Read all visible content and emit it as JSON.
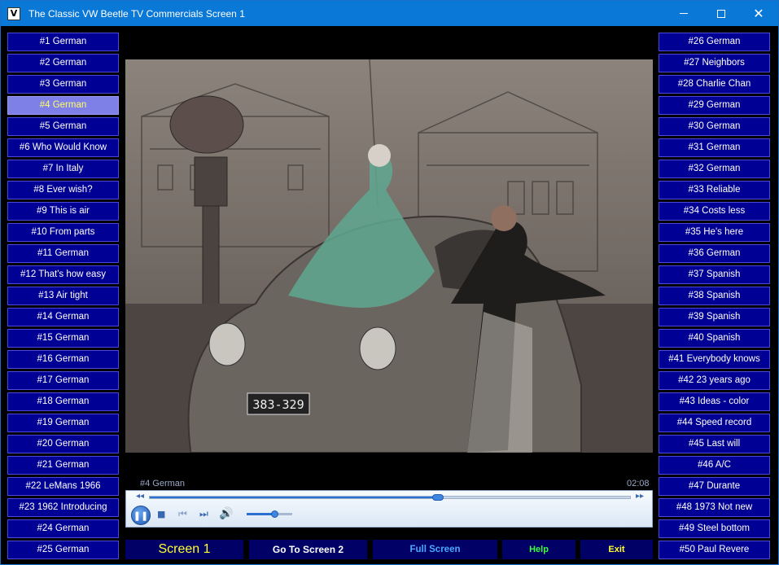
{
  "window": {
    "title": "The Classic VW Beetle TV Commercials  Screen 1",
    "icon": "vw-logo-icon"
  },
  "left_list": [
    "#1 German",
    "#2 German",
    "#3 German",
    "#4 German",
    "#5 German",
    "#6 Who Would Know",
    "#7 In Italy",
    "#8 Ever wish?",
    "#9 This is air",
    "#10 From parts",
    "#11 German",
    "#12 That's how easy",
    "#13 Air tight",
    "#14 German",
    "#15 German",
    "#16 German",
    "#17 German",
    "#18 German",
    "#19 German",
    "#20 German",
    "#21 German",
    "#22 LeMans 1966",
    "#23 1962 Introducing",
    "#24 German",
    "#25 German"
  ],
  "right_list": [
    "#26 German",
    "#27 Neighbors",
    "#28 Charlie Chan",
    "#29 German",
    "#30 German",
    "#31 German",
    "#32 German",
    "#33 Reliable",
    "#34 Costs less",
    "#35 He's here",
    "#36 German",
    "#37 Spanish",
    "#38 Spanish",
    "#39 Spanish",
    "#40 Spanish",
    "#41 Everybody knows",
    "#42 23 years ago",
    "#43 Ideas - color",
    "#44 Speed record",
    "#45 Last will",
    "#46 A/C",
    "#47 Durante",
    "#48 1973 Not new",
    "#49 Steel bottom",
    "#50 Paul Revere"
  ],
  "active_item": "#4 German",
  "player": {
    "caption": "#4 German",
    "time": "02:08",
    "seek_fraction": 0.6,
    "volume_fraction": 0.6,
    "license_plate": "383-329"
  },
  "bottom_bar": {
    "screen_label": "Screen 1",
    "go_label": "Go To Screen 2",
    "full_label": "Full Screen",
    "help_label": "Help",
    "exit_label": "Exit"
  },
  "colors": {
    "titlebar": "#0a78d7",
    "button_bg": "#000094",
    "active_bg": "#7f7fe8",
    "active_text": "#ffff66"
  }
}
